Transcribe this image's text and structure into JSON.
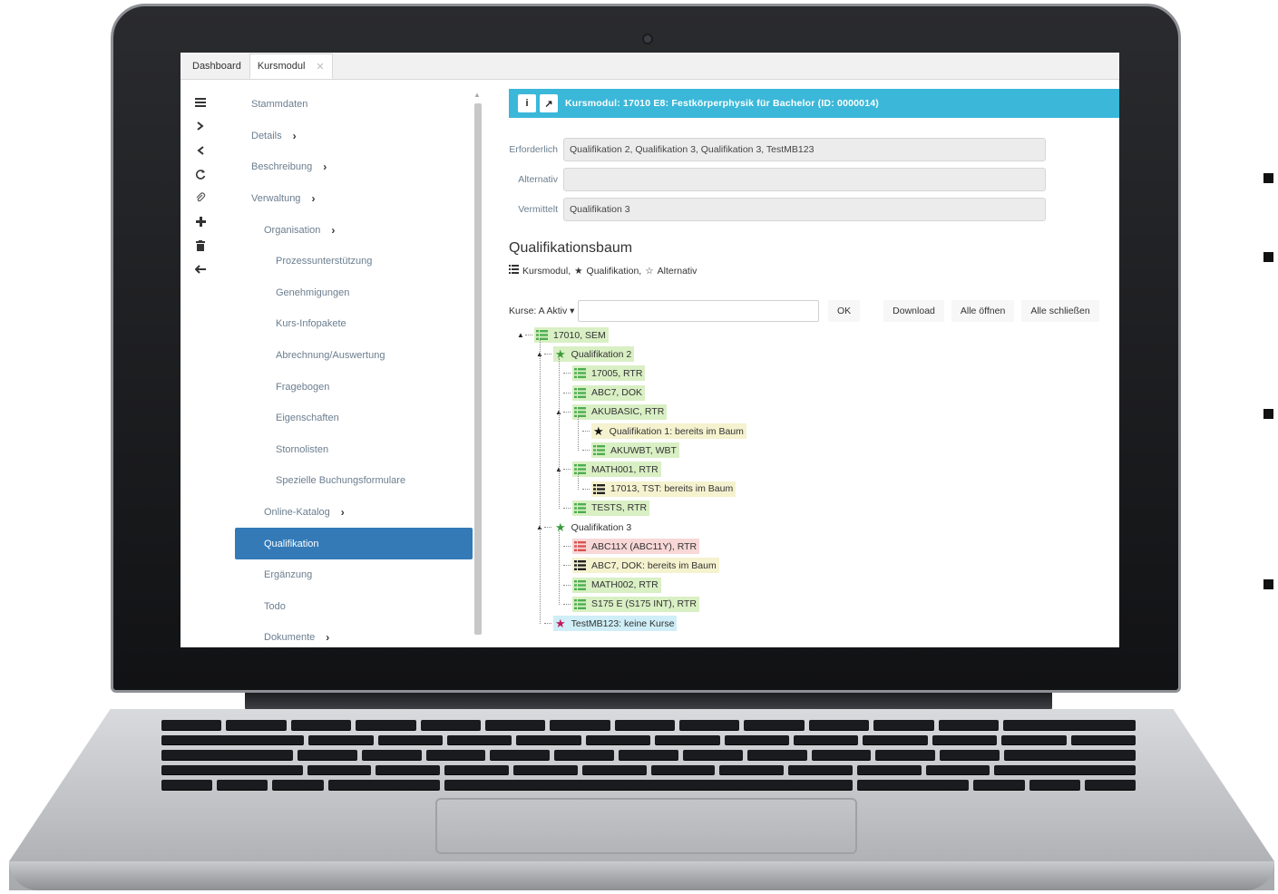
{
  "tabs": [
    {
      "label": "Dashboard"
    },
    {
      "label": "Kursmodul",
      "close": "✕"
    }
  ],
  "toolbar_icons": [
    "menu-icon",
    "chevron-right-icon",
    "chevron-left-icon",
    "refresh-icon",
    "paperclip-icon",
    "plus-icon",
    "trash-icon",
    "arrow-left-icon"
  ],
  "nav": {
    "items": [
      {
        "label": "Stammdaten",
        "level": 0,
        "chevron": false,
        "active": false
      },
      {
        "label": "Details",
        "level": 0,
        "chevron": true,
        "active": false
      },
      {
        "label": "Beschreibung",
        "level": 0,
        "chevron": true,
        "active": false
      },
      {
        "label": "Verwaltung",
        "level": 0,
        "chevron": true,
        "active": false
      },
      {
        "label": "Organisation",
        "level": 1,
        "chevron": true,
        "active": false
      },
      {
        "label": "Prozessunterstützung",
        "level": 2,
        "chevron": false,
        "active": false
      },
      {
        "label": "Genehmigungen",
        "level": 2,
        "chevron": false,
        "active": false
      },
      {
        "label": "Kurs-Infopakete",
        "level": 2,
        "chevron": false,
        "active": false
      },
      {
        "label": "Abrechnung/Auswertung",
        "level": 2,
        "chevron": false,
        "active": false
      },
      {
        "label": "Fragebogen",
        "level": 2,
        "chevron": false,
        "active": false
      },
      {
        "label": "Eigenschaften",
        "level": 2,
        "chevron": false,
        "active": false
      },
      {
        "label": "Stornolisten",
        "level": 2,
        "chevron": false,
        "active": false
      },
      {
        "label": "Spezielle Buchungsformulare",
        "level": 2,
        "chevron": false,
        "active": false
      },
      {
        "label": "Online-Katalog",
        "level": 1,
        "chevron": true,
        "active": false
      },
      {
        "label": "Qualifikation",
        "level": 1,
        "chevron": false,
        "active": true
      },
      {
        "label": "Ergänzung",
        "level": 1,
        "chevron": false,
        "active": false
      },
      {
        "label": "Todo",
        "level": 1,
        "chevron": false,
        "active": false
      },
      {
        "label": "Dokumente",
        "level": 1,
        "chevron": true,
        "active": false
      }
    ],
    "chevron_glyph": "›"
  },
  "banner": {
    "info_glyph": "i",
    "share_glyph": "↗",
    "title": "Kursmodul: 17010 E8: Festkörperphysik für Bachelor (ID: 0000014)"
  },
  "form": {
    "erforderlich": {
      "label": "Erforderlich",
      "value": "Qualifikation 2, Qualifikation 3, Qualifikation 3, TestMB123"
    },
    "alternativ": {
      "label": "Alternativ",
      "value": ""
    },
    "vermittelt": {
      "label": "Vermittelt",
      "value": "Qualifikation 3"
    }
  },
  "tree_title": "Qualifikationsbaum",
  "legend": {
    "kursmodul": "Kursmodul,",
    "qualifikation": "Qualifikation,",
    "alternativ": "Alternativ"
  },
  "controls": {
    "kurse_label": "Kurse: A Aktiv ▾",
    "ok": "OK",
    "download": "Download",
    "alle_oeffnen": "Alle öffnen",
    "alle_schliessen": "Alle schließen"
  },
  "tree": [
    {
      "text": "17010, SEM",
      "depth": 0,
      "icon": "list",
      "color": "green",
      "toggle": "▲"
    },
    {
      "text": "Qualifikation 2",
      "depth": 1,
      "icon": "star",
      "color": "green",
      "toggle": "▲"
    },
    {
      "text": "17005, RTR",
      "depth": 2,
      "icon": "list",
      "color": "green",
      "toggle": ""
    },
    {
      "text": "ABC7, DOK",
      "depth": 2,
      "icon": "list",
      "color": "green",
      "toggle": ""
    },
    {
      "text": "AKUBASIC, RTR",
      "depth": 2,
      "icon": "list",
      "color": "green",
      "toggle": "▲"
    },
    {
      "text": "Qualifikation 1: bereits im Baum",
      "depth": 3,
      "icon": "star-black",
      "color": "yellow",
      "toggle": ""
    },
    {
      "text": "AKUWBT, WBT",
      "depth": 3,
      "icon": "list",
      "color": "green",
      "toggle": ""
    },
    {
      "text": "MATH001, RTR",
      "depth": 2,
      "icon": "list",
      "color": "green",
      "toggle": "▲"
    },
    {
      "text": "17013, TST: bereits im Baum",
      "depth": 3,
      "icon": "list-black",
      "color": "yellow",
      "toggle": ""
    },
    {
      "text": "TESTS, RTR",
      "depth": 2,
      "icon": "list",
      "color": "green",
      "toggle": ""
    },
    {
      "text": "Qualifikation 3",
      "depth": 1,
      "icon": "star",
      "color": "plain",
      "toggle": "▲"
    },
    {
      "text": "ABC11X (ABC11Y), RTR",
      "depth": 2,
      "icon": "list-red",
      "color": "red",
      "toggle": ""
    },
    {
      "text": "ABC7, DOK: bereits im Baum",
      "depth": 2,
      "icon": "list-black",
      "color": "yellow",
      "toggle": ""
    },
    {
      "text": "MATH002, RTR",
      "depth": 2,
      "icon": "list",
      "color": "green",
      "toggle": ""
    },
    {
      "text": "S175 E (S175 INT), RTR",
      "depth": 2,
      "icon": "list",
      "color": "green",
      "toggle": ""
    },
    {
      "text": "TestMB123: keine Kurse",
      "depth": 1,
      "icon": "star-red",
      "color": "blue",
      "toggle": ""
    }
  ],
  "colors": {
    "accent_blue": "#337ab7",
    "banner_cyan": "#3bb8d9",
    "tree_green": "#d9efc4",
    "tree_yellow": "#f5f2cf",
    "tree_red": "#f8d7d7",
    "tree_blue": "#cfeef7",
    "icon_green": "#4caf50",
    "icon_red": "#d9534f",
    "star_green": "#3a9a3a",
    "star_red": "#c2185b"
  }
}
